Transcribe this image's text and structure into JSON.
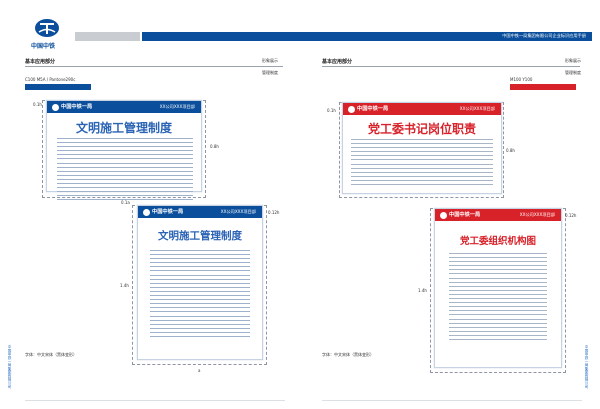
{
  "brand": {
    "logo_text": "中国中铁"
  },
  "header": {
    "title": "中国中铁一局集团有限公司企业标识应用手册"
  },
  "left_panel": {
    "section": "基本应用部分",
    "category": "形象展示",
    "item": "管理制度",
    "color_spec": "C100 M5A / Pantone290c",
    "accent_color": "#0b4f9c",
    "dims": {
      "v1": "0.1h",
      "v2": "0.8h",
      "v3": "1.4h",
      "v4": "0.12h",
      "h1": "0.1a",
      "h2": "a"
    },
    "font_note": "字体：中文宋体（黑体变形）",
    "board_large": {
      "brand": "中国中铁一局",
      "project": "XX公司XXX项目部",
      "title": "文明施工管理制度",
      "line_count": 16
    },
    "board_small": {
      "brand": "中国中铁一局",
      "project": "XX公司XXX项目部",
      "title": "文明施工管理制度",
      "line_count": 22
    }
  },
  "right_panel": {
    "section": "基本应用部分",
    "category": "形象展示",
    "item": "管理制度",
    "color_spec": "M100 Y100",
    "accent_color": "#d8222a",
    "dims": {
      "v1": "0.1h",
      "v2": "0.8h",
      "v3": "1.4h",
      "v4": "0.12h"
    },
    "font_note": "字体：中文宋体（黑体变形）",
    "board_large": {
      "brand": "中国中铁一局",
      "project": "XX公司XXX项目部",
      "title": "党工委书记岗位职责",
      "line_count": 12
    },
    "board_small": {
      "brand": "中国中铁一局",
      "project": "XX公司XXX项目部",
      "title": "党工委组织机构图",
      "line_count": 22
    }
  },
  "side_labels": {
    "left": "中国中铁一局集团有限公司",
    "right": "中国中铁一局集团有限公司"
  }
}
